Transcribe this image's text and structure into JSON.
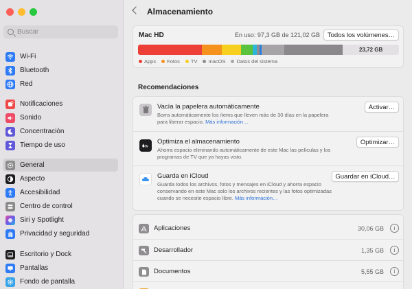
{
  "search": {
    "placeholder": "Buscar"
  },
  "sidebar": {
    "items": [
      {
        "label": "Wi-Fi",
        "icon": "wifi-icon",
        "color": "#2f7bf6"
      },
      {
        "label": "Bluetooth",
        "icon": "bluetooth-icon",
        "color": "#2f7bf6"
      },
      {
        "label": "Red",
        "icon": "globe-icon",
        "color": "#2f7bf6"
      },
      {
        "label": "Notificaciones",
        "icon": "bell-icon",
        "color": "#ef4a47"
      },
      {
        "label": "Sonido",
        "icon": "speaker-icon",
        "color": "#ef4a66"
      },
      {
        "label": "Concentración",
        "icon": "moon-icon",
        "color": "#6157d9"
      },
      {
        "label": "Tiempo de uso",
        "icon": "hourglass-icon",
        "color": "#6157d9"
      },
      {
        "label": "General",
        "icon": "gear-icon",
        "color": "#8c8b8c"
      },
      {
        "label": "Aspecto",
        "icon": "appearance-icon",
        "color": "#1d1d1f"
      },
      {
        "label": "Accesibilidad",
        "icon": "accessibility-icon",
        "color": "#2f7bf6"
      },
      {
        "label": "Centro de control",
        "icon": "control-center-icon",
        "color": "#8c8b8c"
      },
      {
        "label": "Siri y Spotlight",
        "icon": "siri-icon",
        "color": "#b04fe0"
      },
      {
        "label": "Privacidad y seguridad",
        "icon": "hand-icon",
        "color": "#2f7bf6"
      },
      {
        "label": "Escritorio y Dock",
        "icon": "dock-icon",
        "color": "#1d1d1f"
      },
      {
        "label": "Pantallas",
        "icon": "display-icon",
        "color": "#2f7bf6"
      },
      {
        "label": "Fondo de pantalla",
        "icon": "wallpaper-icon",
        "color": "#3aa4e8"
      }
    ]
  },
  "header": {
    "title": "Almacenamiento"
  },
  "disk": {
    "name": "Mac HD",
    "usage": "En uso: 97,3 GB de 121,02 GB",
    "button": "Todos los volúmenes…",
    "free_label": "23,72 GB",
    "segments": [
      {
        "color": "#eb3f38",
        "percent": 24.5
      },
      {
        "color": "#f5921e",
        "percent": 7.5
      },
      {
        "color": "#f7cf1e",
        "percent": 7.5
      },
      {
        "color": "#5ac23c",
        "percent": 4.5
      },
      {
        "color": "#2bb5d9",
        "percent": 1.5
      },
      {
        "color": "#8e8c8e",
        "percent": 1
      },
      {
        "color": "#2b7de0",
        "percent": 1
      },
      {
        "color": "#a6a4a6",
        "percent": 8.5
      },
      {
        "color": "#8a888a",
        "percent": 22.5
      }
    ],
    "legend": [
      {
        "label": "Apps",
        "color": "#eb3f38"
      },
      {
        "label": "Fotos",
        "color": "#f5921e"
      },
      {
        "label": "TV",
        "color": "#f7cf1e"
      },
      {
        "label": "macOS",
        "color": "#8e8c8e"
      },
      {
        "label": "Datos del sistema",
        "color": "#a6a4a6"
      }
    ]
  },
  "recommendations": {
    "title": "Recomendaciones",
    "items": [
      {
        "title": "Vacía la papelera automáticamente",
        "desc": "Borra automáticamente los ítems que lleven más de 30 días en la papelera para liberar espacio.",
        "link": "Más información…",
        "button": "Activar…",
        "icon": "trash-icon"
      },
      {
        "title": "Optimiza el almacenamiento",
        "desc": "Ahorra espacio eliminando automáticamente de este Mac las películas y los programas de TV que ya hayas visto.",
        "link": "",
        "button": "Optimizar…",
        "icon": "apple-tv-icon"
      },
      {
        "title": "Guarda en iCloud",
        "desc": "Guarda todos los archivos, fotos y mensajes en iCloud y ahorra espacio conservando en este Mac solo los archivos recientes y las fotos optimizadas cuando se necesite espacio libre.",
        "link": "Más información…",
        "button": "Guardar en iCloud…",
        "icon": "icloud-icon"
      }
    ]
  },
  "categories": [
    {
      "name": "Aplicaciones",
      "size": "30,06 GB",
      "icon": "applications-icon"
    },
    {
      "name": "Desarrollador",
      "size": "1,35 GB",
      "icon": "hammer-icon"
    },
    {
      "name": "Documentos",
      "size": "5,55 GB",
      "icon": "document-icon"
    },
    {
      "name": "",
      "size": "",
      "icon": "folder-icon"
    }
  ]
}
